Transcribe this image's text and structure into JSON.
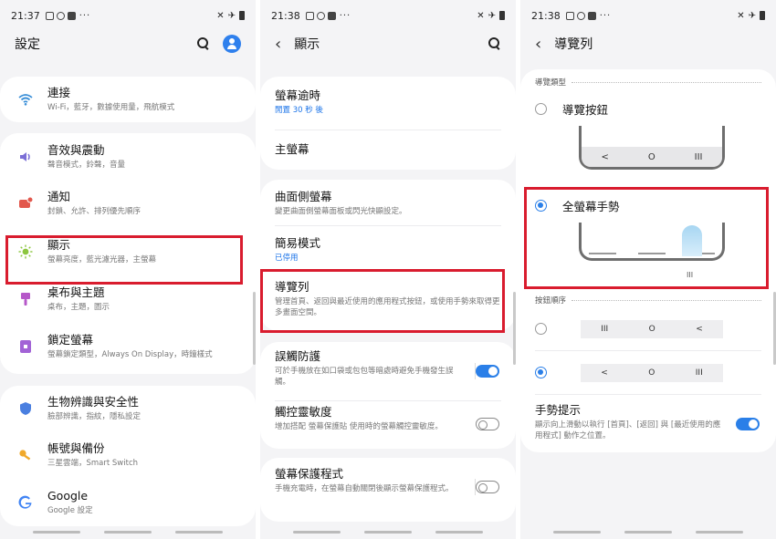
{
  "icons": {
    "status_left": [
      "gallery-icon",
      "at-icon",
      "youtube-icon"
    ],
    "status_right": [
      "mute-icon",
      "airplane-icon",
      "battery-icon"
    ]
  },
  "colors": {
    "accent": "#2a7fe8",
    "highlight": "#d91c2e"
  },
  "screen1": {
    "time": "21:37",
    "dots": "···",
    "title": "設定",
    "items": [
      {
        "title": "連接",
        "sub": "Wi-Fi，藍牙，數據使用量，飛航模式",
        "icon": "wifi-icon"
      },
      {
        "title": "音效與震動",
        "sub": "聲音模式，鈴聲，音量",
        "icon": "sound-icon"
      },
      {
        "title": "通知",
        "sub": "封鎖、允許、排列優先順序",
        "icon": "notification-icon"
      },
      {
        "title": "顯示",
        "sub": "螢幕亮度，藍光濾光器，主螢幕",
        "icon": "brightness-icon"
      },
      {
        "title": "桌布與主題",
        "sub": "桌布，主題，圖示",
        "icon": "theme-icon"
      },
      {
        "title": "鎖定螢幕",
        "sub": "螢幕鎖定類型，Always On Display，時鐘樣式",
        "icon": "lock-icon"
      },
      {
        "title": "生物辨識與安全性",
        "sub": "臉部辨識，指紋，隱私設定",
        "icon": "shield-icon"
      },
      {
        "title": "帳號與備份",
        "sub": "三星雲端，Smart Switch",
        "icon": "key-icon"
      },
      {
        "title": "Google",
        "sub": "Google 設定",
        "icon": "google-icon"
      }
    ]
  },
  "screen2": {
    "time": "21:38",
    "dots": "···",
    "title": "顯示",
    "items": [
      {
        "title": "螢幕逾時",
        "sub": "閒置 30 秒 後"
      },
      {
        "title": "主螢幕",
        "sub": ""
      },
      {
        "title": "曲面側螢幕",
        "sub": "變更曲面側螢幕面板或閃光快顯設定。"
      },
      {
        "title": "簡易模式",
        "sub": "已停用"
      },
      {
        "title": "導覽列",
        "sub": "管理首頁、返回與最近使用的應用程式按鈕，或使用手勢來取得更多畫面空間。"
      },
      {
        "title": "誤觸防護",
        "sub": "可於手機放在如口袋或包包等暗處時避免手機發生誤觸。",
        "toggle": true
      },
      {
        "title": "觸控靈敏度",
        "sub": "增加搭配 螢幕保護貼 使用時的螢幕觸控靈敏度。",
        "toggle": false
      },
      {
        "title": "螢幕保護程式",
        "sub": "手機充電時，在螢幕自動關閉後顯示螢幕保護程式。",
        "toggle": false
      }
    ]
  },
  "screen3": {
    "time": "21:38",
    "dots": "···",
    "title": "導覽列",
    "nav_type_header": "導覽類型",
    "option_buttons": "導覽按鈕",
    "option_gestures": "全螢幕手勢",
    "button_order_header": "按鈕順序",
    "order1": [
      "III",
      "O",
      "<"
    ],
    "order2": [
      "<",
      "O",
      "III"
    ],
    "preview_buttons": [
      "<",
      "O",
      "III"
    ],
    "gesture_mark": "III",
    "hint_title": "手勢提示",
    "hint_sub": "顯示向上滑動以執行 [首頁]、[返回] 與 [最近使用的應用程式] 動作之位置。",
    "hint_on": true,
    "selected_type": "全螢幕手勢",
    "selected_order": 2
  }
}
